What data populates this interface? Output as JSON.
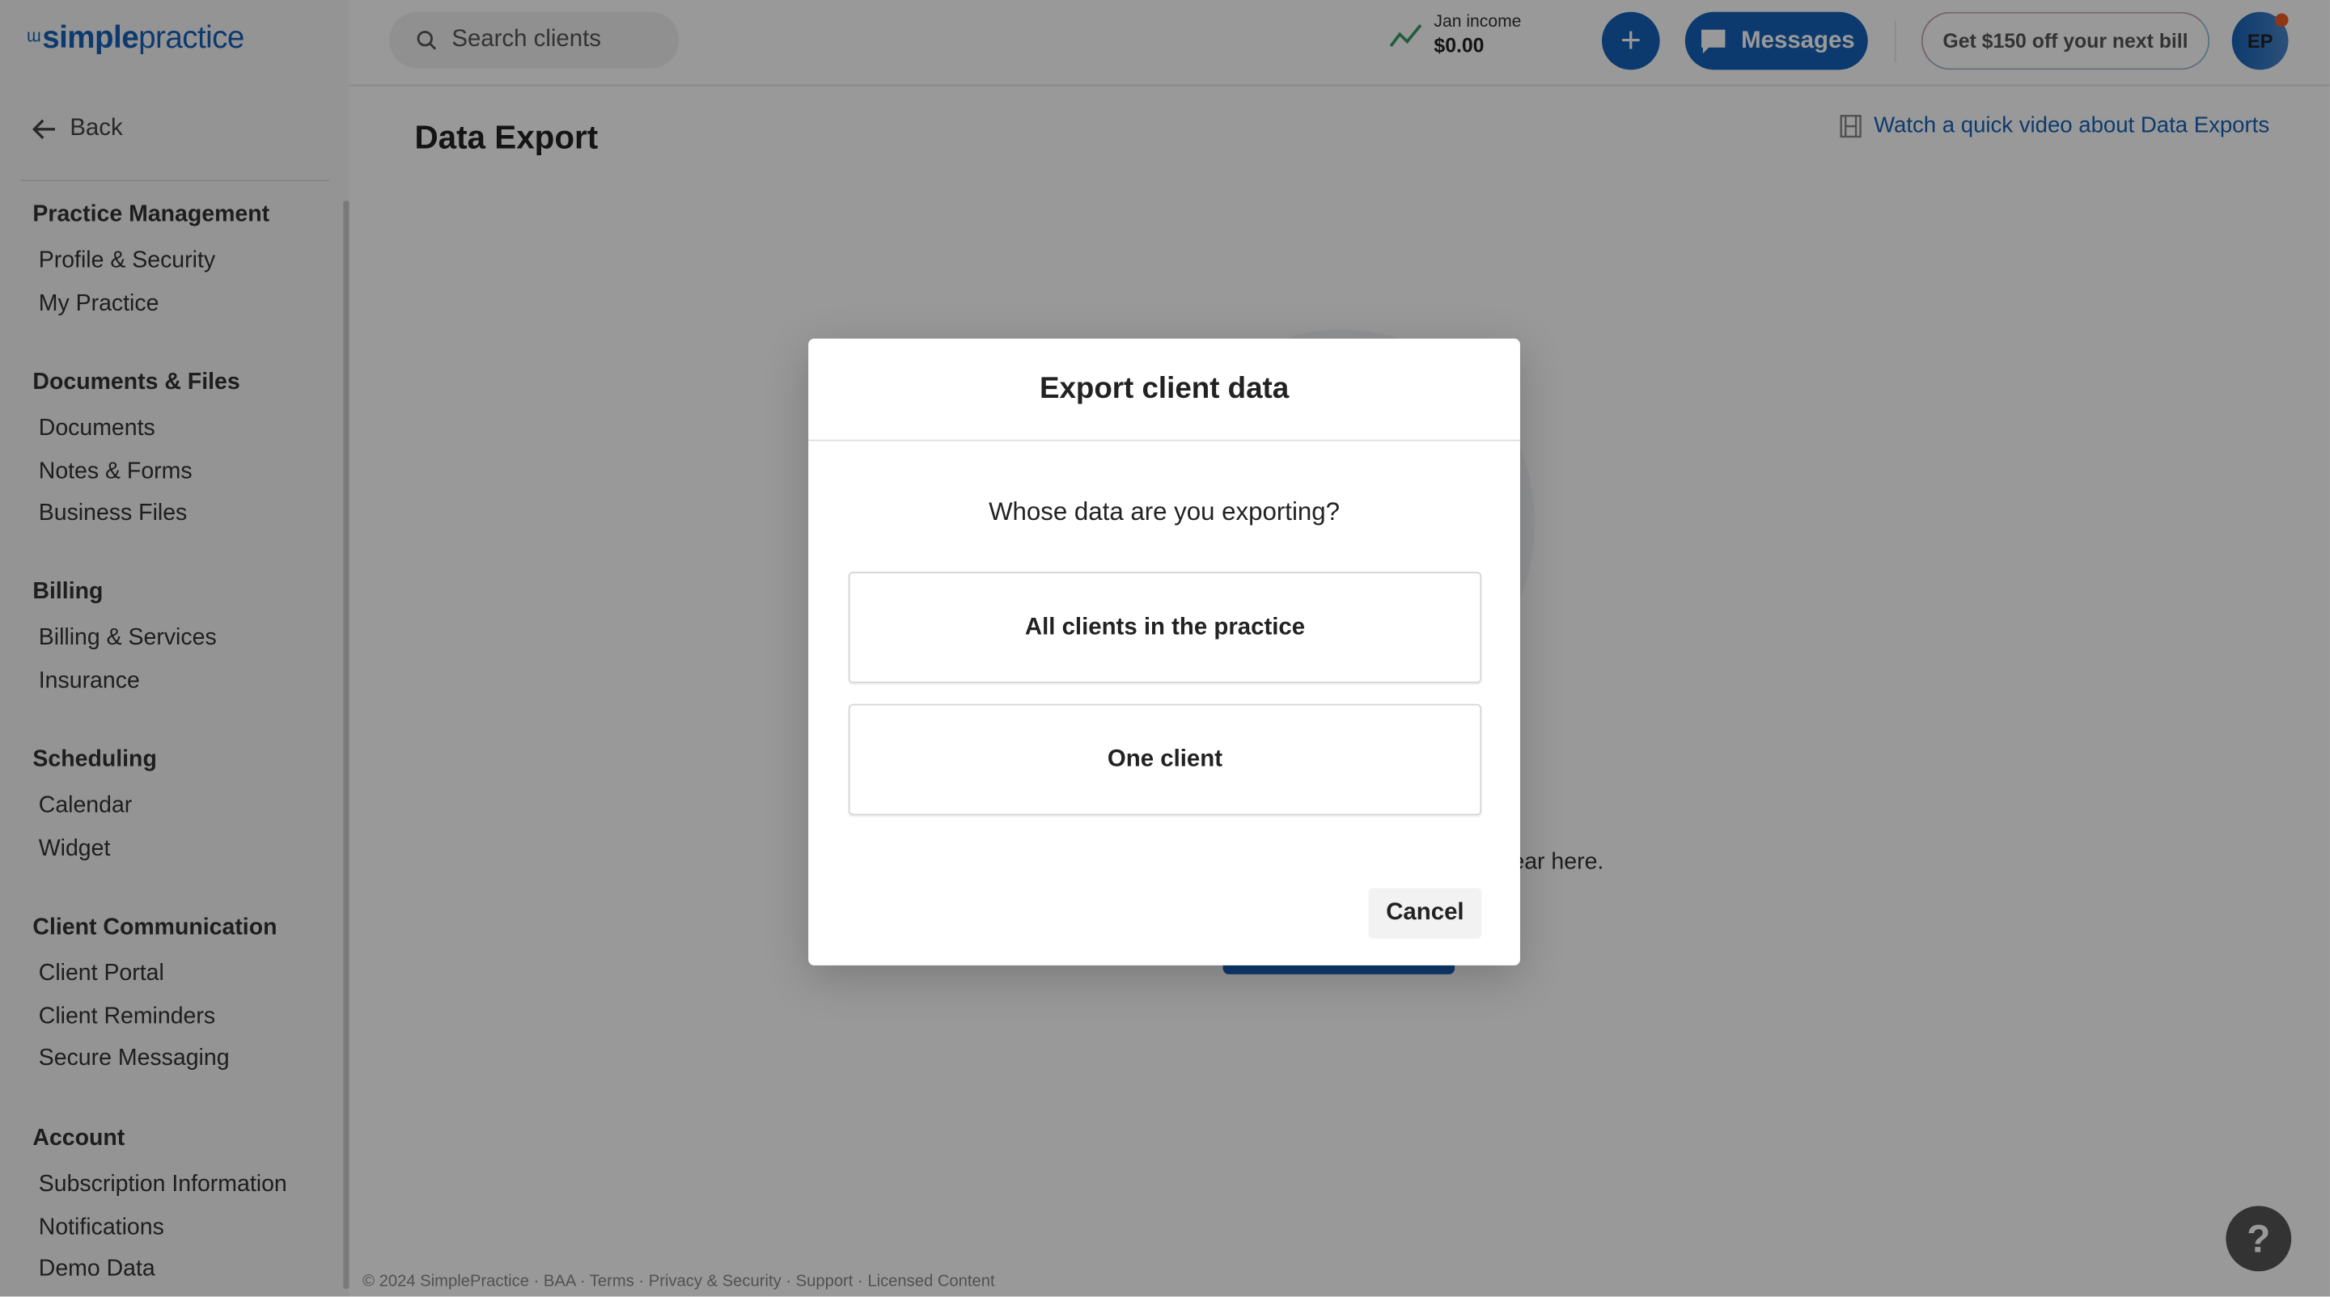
{
  "brand": {
    "logo_bold": "simple",
    "logo_light": "practice",
    "color": "#1662b8"
  },
  "sidebar": {
    "back_label": "Back",
    "sections": [
      {
        "title": "Practice Management",
        "items": [
          "Profile & Security",
          "My Practice"
        ]
      },
      {
        "title": "Documents & Files",
        "items": [
          "Documents",
          "Notes & Forms",
          "Business Files"
        ]
      },
      {
        "title": "Billing",
        "items": [
          "Billing & Services",
          "Insurance"
        ]
      },
      {
        "title": "Scheduling",
        "items": [
          "Calendar",
          "Widget"
        ]
      },
      {
        "title": "Client Communication",
        "items": [
          "Client Portal",
          "Client Reminders",
          "Secure Messaging"
        ]
      },
      {
        "title": "Account",
        "items": [
          "Subscription Information",
          "Notifications",
          "Demo Data"
        ]
      }
    ]
  },
  "header": {
    "search_placeholder": "Search clients",
    "income_label": "Jan income",
    "income_value": "$0.00",
    "add_icon": "plus-icon",
    "messages_label": "Messages",
    "promo_label": "Get $150 off your next bill",
    "avatar_initials": "EP"
  },
  "page": {
    "title": "Data Export",
    "video_link": "Watch a quick video about Data Exports",
    "empty_text_visible": "ppear here."
  },
  "footer": {
    "text": "© 2024 SimplePractice · BAA · Terms · Privacy & Security · Support · Licensed Content"
  },
  "help": {
    "label": "?"
  },
  "modal": {
    "title": "Export client data",
    "question": "Whose data are you exporting?",
    "options": [
      "All clients in the practice",
      "One client"
    ],
    "cancel_label": "Cancel"
  }
}
